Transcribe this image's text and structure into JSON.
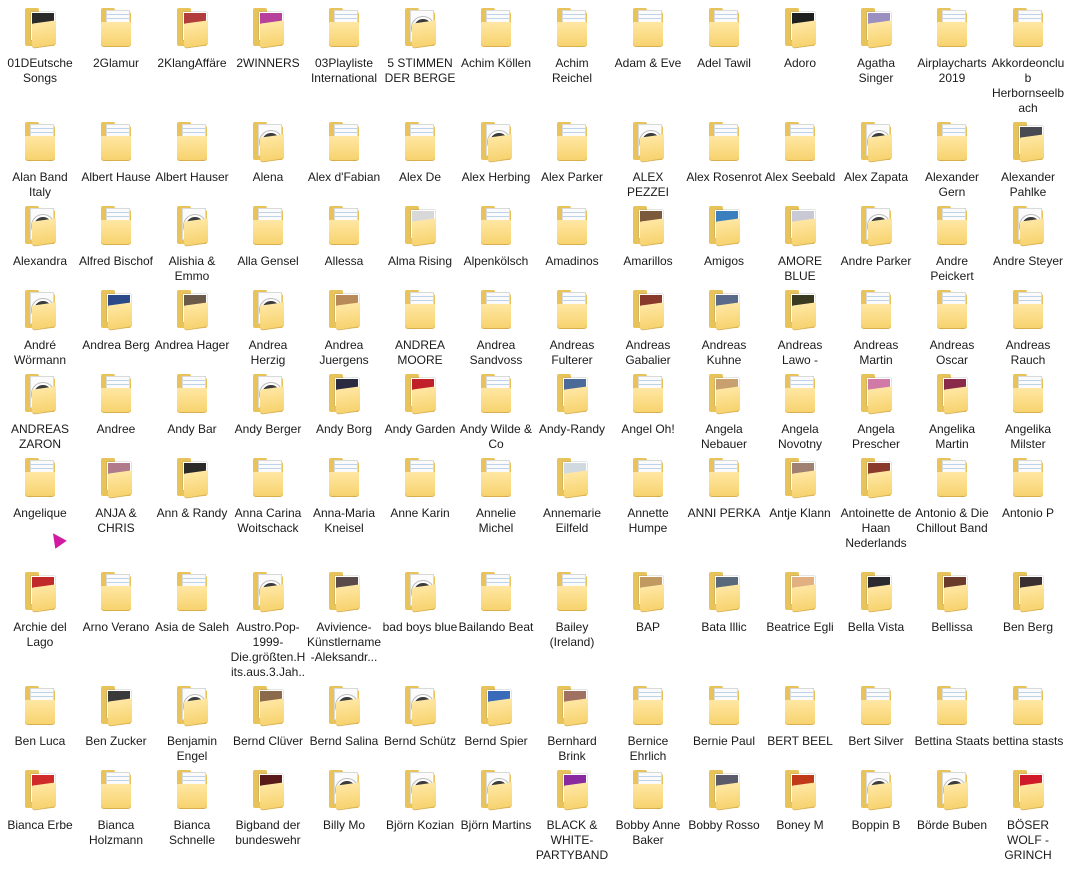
{
  "folders": [
    {
      "label": "01DEutsche Songs",
      "icon": "album-cover-icon",
      "cover": "#2a2a2a"
    },
    {
      "label": "2Glamur",
      "icon": "folder-icon"
    },
    {
      "label": "2KlangAffäre",
      "icon": "album-cover-icon",
      "cover": "#b23b3b"
    },
    {
      "label": "2WINNERS",
      "icon": "album-cover-icon",
      "cover": "#b7409a"
    },
    {
      "label": "03Playliste International",
      "icon": "folder-icon"
    },
    {
      "label": "5 STIMMEN DER BERGE",
      "icon": "media-folder-icon"
    },
    {
      "label": "Achim Köllen",
      "icon": "folder-icon"
    },
    {
      "label": "Achim Reichel",
      "icon": "folder-icon"
    },
    {
      "label": "Adam & Eve",
      "icon": "folder-icon"
    },
    {
      "label": "Adel Tawil",
      "icon": "folder-icon"
    },
    {
      "label": "Adoro",
      "icon": "album-cover-icon",
      "cover": "#1e1e1e"
    },
    {
      "label": "Agatha Singer",
      "icon": "album-cover-icon",
      "cover": "#9a8fc0"
    },
    {
      "label": "Airplaycharts 2019",
      "icon": "folder-icon"
    },
    {
      "label": "Akkordeonclub Herbornseelbach",
      "icon": "folder-icon"
    },
    {
      "label": "Alan Band Italy",
      "icon": "folder-icon"
    },
    {
      "label": "Albert Hause",
      "icon": "folder-icon"
    },
    {
      "label": "Albert Hauser",
      "icon": "folder-icon"
    },
    {
      "label": "Alena",
      "icon": "media-folder-icon"
    },
    {
      "label": "Alex d'Fabian",
      "icon": "folder-icon"
    },
    {
      "label": "Alex De",
      "icon": "folder-icon"
    },
    {
      "label": "Alex Herbing",
      "icon": "media-folder-icon"
    },
    {
      "label": "Alex Parker",
      "icon": "folder-icon"
    },
    {
      "label": "ALEX PEZZEI",
      "icon": "media-folder-icon"
    },
    {
      "label": "Alex Rosenrot",
      "icon": "folder-icon"
    },
    {
      "label": "Alex Seebald",
      "icon": "folder-icon"
    },
    {
      "label": "Alex Zapata",
      "icon": "media-folder-icon"
    },
    {
      "label": "Alexander Gern",
      "icon": "folder-icon"
    },
    {
      "label": "Alexander Pahlke",
      "icon": "album-cover-icon",
      "cover": "#4a4a52"
    },
    {
      "label": "Alexandra",
      "icon": "media-folder-icon"
    },
    {
      "label": "Alfred Bischof",
      "icon": "folder-icon"
    },
    {
      "label": "Alishia & Emmo",
      "icon": "media-folder-icon"
    },
    {
      "label": "Alla Gensel",
      "icon": "folder-icon"
    },
    {
      "label": "Allessa",
      "icon": "folder-icon"
    },
    {
      "label": "Alma Rising",
      "icon": "album-cover-icon",
      "cover": "#d8d8d8"
    },
    {
      "label": "Alpenkölsch",
      "icon": "folder-icon"
    },
    {
      "label": "Amadinos",
      "icon": "folder-icon"
    },
    {
      "label": "Amarillos",
      "icon": "album-cover-icon",
      "cover": "#7a5a3a"
    },
    {
      "label": "Amigos",
      "icon": "album-cover-icon",
      "cover": "#3b7fbf"
    },
    {
      "label": "AMORE BLUE",
      "icon": "album-cover-icon",
      "cover": "#c9c9d6"
    },
    {
      "label": "Andre Parker",
      "icon": "media-folder-icon"
    },
    {
      "label": "Andre Peickert",
      "icon": "folder-icon"
    },
    {
      "label": "Andre Steyer",
      "icon": "media-folder-icon"
    },
    {
      "label": "André Wörmann",
      "icon": "media-folder-icon"
    },
    {
      "label": "Andrea Berg",
      "icon": "album-cover-icon",
      "cover": "#2b4a8a"
    },
    {
      "label": "Andrea Hager",
      "icon": "album-cover-icon",
      "cover": "#6a5a4a"
    },
    {
      "label": "Andrea Herzig",
      "icon": "media-folder-icon"
    },
    {
      "label": "Andrea Juergens",
      "icon": "album-cover-icon",
      "cover": "#b88a5a"
    },
    {
      "label": "ANDREA MOORE",
      "icon": "folder-icon"
    },
    {
      "label": "Andrea Sandvoss",
      "icon": "folder-icon"
    },
    {
      "label": "Andreas Fulterer",
      "icon": "folder-icon"
    },
    {
      "label": "Andreas Gabalier",
      "icon": "album-cover-icon",
      "cover": "#8a3a2a"
    },
    {
      "label": "Andreas Kuhne",
      "icon": "album-cover-icon",
      "cover": "#5a6a8a"
    },
    {
      "label": "Andreas Lawo -",
      "icon": "album-cover-icon",
      "cover": "#3a3a20"
    },
    {
      "label": "Andreas Martin",
      "icon": "folder-icon"
    },
    {
      "label": "Andreas Oscar",
      "icon": "folder-icon"
    },
    {
      "label": "Andreas Rauch",
      "icon": "folder-icon"
    },
    {
      "label": "ANDREAS ZARON",
      "icon": "media-folder-icon"
    },
    {
      "label": "Andree",
      "icon": "folder-icon"
    },
    {
      "label": "Andy Bar",
      "icon": "folder-icon"
    },
    {
      "label": "Andy Berger",
      "icon": "media-folder-icon"
    },
    {
      "label": "Andy Borg",
      "icon": "album-cover-icon",
      "cover": "#2a2a40"
    },
    {
      "label": "Andy Garden",
      "icon": "album-cover-icon",
      "cover": "#c0202a"
    },
    {
      "label": "Andy Wilde & Co",
      "icon": "folder-icon"
    },
    {
      "label": "Andy-Randy",
      "icon": "album-cover-icon",
      "cover": "#4a6a9a"
    },
    {
      "label": "Angel Oh!",
      "icon": "folder-icon"
    },
    {
      "label": "Angela Nebauer",
      "icon": "album-cover-icon",
      "cover": "#c8a070"
    },
    {
      "label": "Angela Novotny",
      "icon": "folder-icon"
    },
    {
      "label": "Angela Prescher",
      "icon": "album-cover-icon",
      "cover": "#d07aa8"
    },
    {
      "label": "Angelika Martin",
      "icon": "album-cover-icon",
      "cover": "#8a2a4a"
    },
    {
      "label": "Angelika Milster",
      "icon": "folder-icon"
    },
    {
      "label": "Angelique",
      "icon": "folder-icon"
    },
    {
      "label": "ANJA & CHRIS",
      "icon": "album-cover-icon",
      "cover": "#b07a8a"
    },
    {
      "label": "Ann & Randy",
      "icon": "album-cover-icon",
      "cover": "#2a2a2a"
    },
    {
      "label": "Anna Carina Woitschack",
      "icon": "folder-icon"
    },
    {
      "label": "Anna-Maria Kneisel",
      "icon": "folder-icon"
    },
    {
      "label": "Anne Karin",
      "icon": "folder-icon"
    },
    {
      "label": "Annelie Michel",
      "icon": "folder-icon"
    },
    {
      "label": "Annemarie Eilfeld",
      "icon": "album-cover-icon",
      "cover": "#d0d8e0"
    },
    {
      "label": "Annette Humpe",
      "icon": "folder-icon"
    },
    {
      "label": "ANNI PERKA",
      "icon": "folder-icon"
    },
    {
      "label": "Antje Klann",
      "icon": "album-cover-icon",
      "cover": "#a08070"
    },
    {
      "label": "Antoinette de Haan Nederlands",
      "icon": "album-cover-icon",
      "cover": "#8a3a2a"
    },
    {
      "label": "Antonio & Die Chillout Band",
      "icon": "folder-icon"
    },
    {
      "label": "Antonio P",
      "icon": "folder-icon"
    },
    {
      "label": "Archie del Lago",
      "icon": "album-cover-icon",
      "cover": "#c02a2a"
    },
    {
      "label": "Arno Verano",
      "icon": "folder-icon"
    },
    {
      "label": "Asia de Saleh",
      "icon": "folder-icon"
    },
    {
      "label": "Austro.Pop-1999-Die.größten.Hits.aus.3.Jah...",
      "icon": "media-folder-icon"
    },
    {
      "label": "Avivience-Künstlername-Aleksandr...",
      "icon": "album-cover-icon",
      "cover": "#5a4a4a"
    },
    {
      "label": "bad boys blue",
      "icon": "media-folder-icon"
    },
    {
      "label": "Bailando Beat",
      "icon": "folder-icon"
    },
    {
      "label": "Bailey (Ireland)",
      "icon": "folder-icon"
    },
    {
      "label": "BAP",
      "icon": "album-cover-icon",
      "cover": "#c09a60"
    },
    {
      "label": "Bata Illic",
      "icon": "album-cover-icon",
      "cover": "#5a6a7a"
    },
    {
      "label": "Beatrice Egli",
      "icon": "album-cover-icon",
      "cover": "#e0b080"
    },
    {
      "label": "Bella Vista",
      "icon": "album-cover-icon",
      "cover": "#2a2a30"
    },
    {
      "label": "Bellissa",
      "icon": "album-cover-icon",
      "cover": "#6a3a2a"
    },
    {
      "label": "Ben Berg",
      "icon": "album-cover-icon",
      "cover": "#3a3030"
    },
    {
      "label": "Ben Luca",
      "icon": "folder-icon"
    },
    {
      "label": "Ben Zucker",
      "icon": "album-cover-icon",
      "cover": "#3a3a3a"
    },
    {
      "label": "Benjamin Engel",
      "icon": "media-folder-icon"
    },
    {
      "label": "Bernd Clüver",
      "icon": "album-cover-icon",
      "cover": "#8a6a4a"
    },
    {
      "label": "Bernd Salina",
      "icon": "media-folder-icon"
    },
    {
      "label": "Bernd Schütz",
      "icon": "media-folder-icon"
    },
    {
      "label": "Bernd Spier",
      "icon": "album-cover-icon",
      "cover": "#3a6aba"
    },
    {
      "label": "Bernhard Brink",
      "icon": "album-cover-icon",
      "cover": "#a07060"
    },
    {
      "label": "Bernice Ehrlich",
      "icon": "folder-icon"
    },
    {
      "label": "Bernie Paul",
      "icon": "folder-icon"
    },
    {
      "label": "BERT BEEL",
      "icon": "folder-icon"
    },
    {
      "label": "Bert Silver",
      "icon": "folder-icon"
    },
    {
      "label": "Bettina Staats",
      "icon": "folder-icon"
    },
    {
      "label": "bettina stasts",
      "icon": "folder-icon"
    },
    {
      "label": "Bianca Erbe",
      "icon": "album-cover-icon",
      "cover": "#d02a2a"
    },
    {
      "label": "Bianca Holzmann",
      "icon": "folder-icon"
    },
    {
      "label": "Bianca Schnelle",
      "icon": "folder-icon"
    },
    {
      "label": "Bigband der bundeswehr",
      "icon": "album-cover-icon",
      "cover": "#5a1a1a"
    },
    {
      "label": "Billy Mo",
      "icon": "media-folder-icon"
    },
    {
      "label": "Björn Kozian",
      "icon": "media-folder-icon"
    },
    {
      "label": "Björn Martins",
      "icon": "media-folder-icon"
    },
    {
      "label": "BLACK & WHITE-PARTYBAND",
      "icon": "album-cover-icon",
      "cover": "#8a2aa0"
    },
    {
      "label": "Bobby Anne Baker",
      "icon": "folder-icon"
    },
    {
      "label": "Bobby Rosso",
      "icon": "album-cover-icon",
      "cover": "#5a5a6a"
    },
    {
      "label": "Boney M",
      "icon": "album-cover-icon",
      "cover": "#c03a1a"
    },
    {
      "label": "Boppin B",
      "icon": "media-folder-icon"
    },
    {
      "label": "Börde Buben",
      "icon": "media-folder-icon"
    },
    {
      "label": "BÖSER WOLF - GRINCH",
      "icon": "album-cover-icon",
      "cover": "#d01a2a"
    }
  ],
  "cursor": {
    "icon": "mouse-cursor-icon",
    "color": "#d21aa0"
  }
}
